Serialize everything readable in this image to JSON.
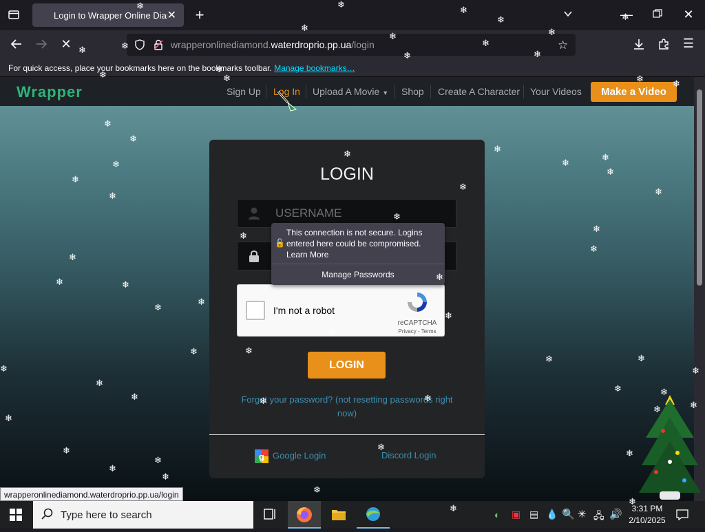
{
  "browser": {
    "tab_title": "Login to Wrapper Online Diamond",
    "url_host_prefix": "wrapperonlinediamond.",
    "url_host_domain": "waterdroprio.pp.ua",
    "url_path": "/login",
    "bookmarks_text": "For quick access, place your bookmarks here on the bookmarks toolbar.",
    "bookmarks_link": "Manage bookmarks…",
    "status_url": "wrapperonlinediamond.waterdroprio.pp.ua/login"
  },
  "site_nav": {
    "logo": "Wrapper",
    "items": [
      {
        "label": "Sign Up"
      },
      {
        "label": "Log In"
      },
      {
        "label": "Upload A Movie"
      },
      {
        "label": "Shop"
      },
      {
        "label": "Create A Character"
      },
      {
        "label": "Your Videos"
      }
    ],
    "cta": "Make a Video"
  },
  "login": {
    "heading": "LOGIN",
    "username_placeholder": "USERNAME",
    "captcha_label": "I'm not a robot",
    "captcha_brand": "reCAPTCHA",
    "captcha_links": "Privacy - Terms",
    "submit": "LOGIN",
    "forgot": "Forgot your password? (not resetting passwords right now)",
    "google": "Google Login",
    "discord": "Discord Login"
  },
  "insecure_popup": {
    "message": "This connection is not secure. Logins entered here could be compromised.",
    "learn_more": "Learn More",
    "manage": "Manage Passwords"
  },
  "taskbar": {
    "search_placeholder": "Type here to search",
    "time": "3:31 PM",
    "date": "2/10/2025"
  },
  "colors": {
    "accent_orange": "#e8901a",
    "link_blue": "#3d8fb0",
    "card_bg": "#232426"
  }
}
